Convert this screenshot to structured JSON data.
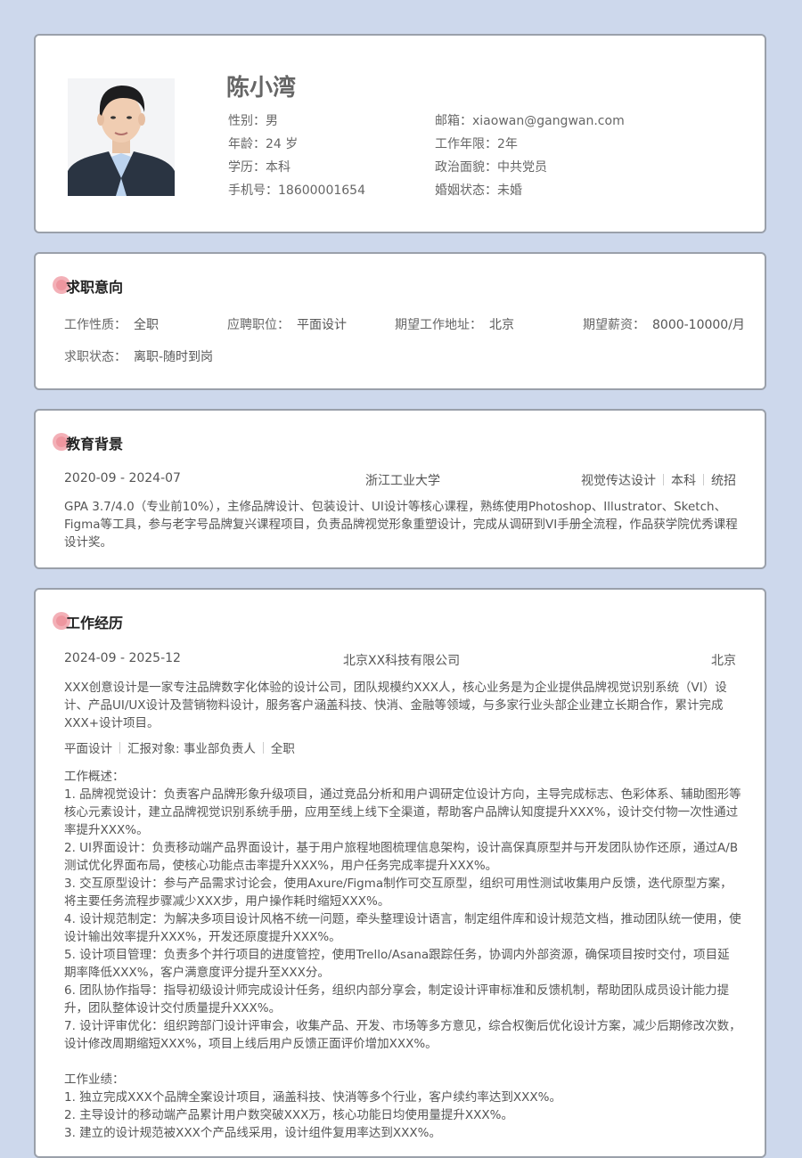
{
  "profile": {
    "name": "陈小湾",
    "left": [
      {
        "label": "性别：",
        "value": "男"
      },
      {
        "label": "年龄：",
        "value": "24 岁"
      },
      {
        "label": "学历：",
        "value": "本科"
      },
      {
        "label": "手机号：",
        "value": "18600001654"
      }
    ],
    "right": [
      {
        "label": "邮箱：",
        "value": "xiaowan@gangwan.com"
      },
      {
        "label": "工作年限：",
        "value": "2年"
      },
      {
        "label": "政治面貌：",
        "value": "中共党员"
      },
      {
        "label": "婚姻状态：",
        "value": "未婚"
      }
    ]
  },
  "intent": {
    "title": "求职意向",
    "items": [
      {
        "label": "工作性质：",
        "value": "全职"
      },
      {
        "label": "应聘职位：",
        "value": "平面设计"
      },
      {
        "label": "期望工作地址：",
        "value": "北京"
      },
      {
        "label": "期望薪资：",
        "value": "8000-10000/月"
      },
      {
        "label": "求职状态：",
        "value": "离职-随时到岗"
      }
    ]
  },
  "education": {
    "title": "教育背景",
    "period": "2020-09 - 2024-07",
    "school": "浙江工业大学",
    "tags": [
      "视觉传达设计",
      "本科",
      "统招"
    ],
    "desc": "GPA 3.7/4.0（专业前10%），主修品牌设计、包装设计、UI设计等核心课程，熟练使用Photoshop、Illustrator、Sketch、Figma等工具，参与老字号品牌复兴课程项目，负责品牌视觉形象重塑设计，完成从调研到VI手册全流程，作品获学院优秀课程设计奖。"
  },
  "work": {
    "title": "工作经历",
    "period": "2024-09 - 2025-12",
    "company": "北京XX科技有限公司",
    "city": "北京",
    "company_desc": "XXX创意设计是一家专注品牌数字化体验的设计公司，团队规模约XXX人，核心业务是为企业提供品牌视觉识别系统（VI）设计、产品UI/UX设计及营销物料设计，服务客户涵盖科技、快消、金融等领域，与多家行业头部企业建立长期合作，累计完成XXX+设计项目。",
    "tags": [
      "平面设计",
      "汇报对象: 事业部负责人",
      "全职"
    ],
    "overview_label": "工作概述：",
    "overview": [
      "1. 品牌视觉设计：负责客户品牌形象升级项目，通过竞品分析和用户调研定位设计方向，主导完成标志、色彩体系、辅助图形等核心元素设计，建立品牌视觉识别系统手册，应用至线上线下全渠道，帮助客户品牌认知度提升XXX%，设计交付物一次性通过率提升XXX%。",
      "2. UI界面设计：负责移动端产品界面设计，基于用户旅程地图梳理信息架构，设计高保真原型并与开发团队协作还原，通过A/B测试优化界面布局，使核心功能点击率提升XXX%，用户任务完成率提升XXX%。",
      "3. 交互原型设计：参与产品需求讨论会，使用Axure/Figma制作可交互原型，组织可用性测试收集用户反馈，迭代原型方案，将主要任务流程步骤减少XXX步，用户操作耗时缩短XXX%。",
      "4. 设计规范制定：为解决多项目设计风格不统一问题，牵头整理设计语言，制定组件库和设计规范文档，推动团队统一使用，使设计输出效率提升XXX%，开发还原度提升XXX%。",
      "5. 设计项目管理：负责多个并行项目的进度管控，使用Trello/Asana跟踪任务，协调内外部资源，确保项目按时交付，项目延期率降低XXX%，客户满意度评分提升至XXX分。",
      "6. 团队协作指导：指导初级设计师完成设计任务，组织内部分享会，制定设计评审标准和反馈机制，帮助团队成员设计能力提升，团队整体设计交付质量提升XXX%。",
      "7. 设计评审优化：组织跨部门设计评审会，收集产品、开发、市场等多方意见，综合权衡后优化设计方案，减少后期修改次数，设计修改周期缩短XXX%，项目上线后用户反馈正面评价增加XXX%。"
    ],
    "results_label": "工作业绩：",
    "results": [
      "1. 独立完成XXX个品牌全案设计项目，涵盖科技、快消等多个行业，客户续约率达到XXX%。",
      "2. 主导设计的移动端产品累计用户数突破XXX万，核心功能日均使用量提升XXX%。",
      "3. 建立的设计规范被XXX个产品线采用，设计组件复用率达到XXX%。"
    ]
  }
}
